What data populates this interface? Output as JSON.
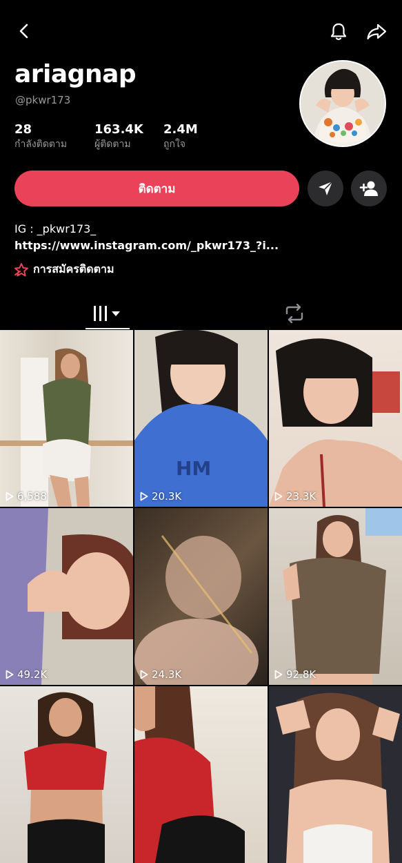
{
  "header": {
    "username": "ariagnap",
    "handle": "@pkwr173"
  },
  "stats": [
    {
      "value": "28",
      "label": "กำลังติดตาม"
    },
    {
      "value": "163.4K",
      "label": "ผู้ติดตาม"
    },
    {
      "value": "2.4M",
      "label": "ถูกใจ"
    }
  ],
  "actions": {
    "follow_label": "ติดตาม",
    "accent_color": "#ea4359"
  },
  "bio": {
    "line1": "IG : _pkwr173_",
    "link": "https://www.instagram.com/_pkwr173_?i...",
    "subscription": "การสมัครติดตาม"
  },
  "tabs": [
    {
      "icon": "grid-icon",
      "selected": true
    },
    {
      "icon": "repost-icon",
      "selected": false
    }
  ],
  "videos": [
    {
      "views": "6,588"
    },
    {
      "views": "20.3K"
    },
    {
      "views": "23.3K"
    },
    {
      "views": "49.2K"
    },
    {
      "views": "24.3K"
    },
    {
      "views": "92.8K"
    },
    {
      "views": ""
    },
    {
      "views": ""
    },
    {
      "views": ""
    }
  ]
}
